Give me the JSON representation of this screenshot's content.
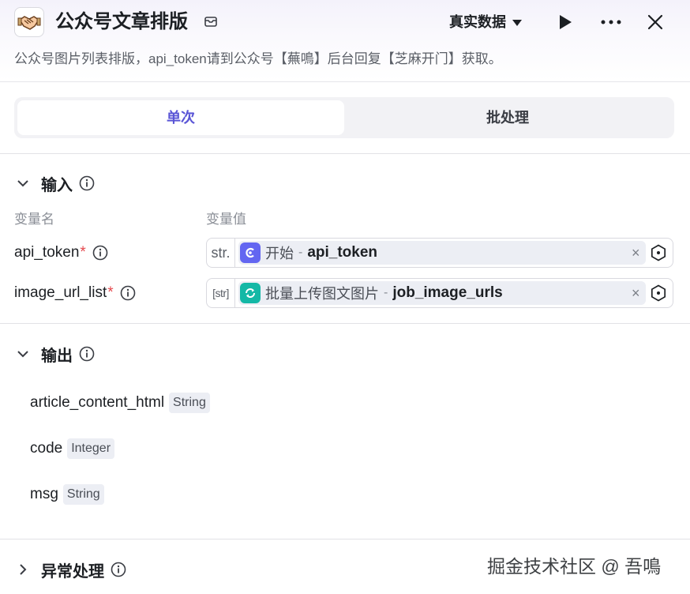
{
  "header": {
    "title": "公众号文章排版",
    "description": "公众号图片列表排版，api_token请到公众号【蕪鳴】后台回复【芝麻开门】获取。",
    "mode": "真实数据",
    "icons": [
      "handshake-icon",
      "card-icon",
      "caret-down-icon",
      "play-icon",
      "more-icon",
      "close-icon"
    ]
  },
  "tabs": [
    {
      "label": "单次",
      "active": true
    },
    {
      "label": "批处理",
      "active": false
    }
  ],
  "input_section": {
    "title": "输入",
    "col_name": "变量名",
    "col_value": "变量值",
    "rows": [
      {
        "name": "api_token",
        "required": "*",
        "type": "str.",
        "node": "开始",
        "sep": "-",
        "field": "api_token",
        "clear": "×"
      },
      {
        "name": "image_url_list",
        "required": "*",
        "type": "[str]",
        "node": "批量上传图文图片",
        "sep": "-",
        "field": "job_image_urls",
        "clear": "×"
      }
    ]
  },
  "output_section": {
    "title": "输出",
    "rows": [
      {
        "name": "article_content_html",
        "type": "String"
      },
      {
        "name": "code",
        "type": "Integer"
      },
      {
        "name": "msg",
        "type": "String"
      }
    ]
  },
  "error_section": {
    "title": "异常处理"
  },
  "watermark": "掘金技术社区 @ 吾鳴",
  "colors": {
    "accent": "#5a55d6",
    "start_node": "#6366f1",
    "loop_node": "#14b8a6",
    "required": "#e5484d"
  }
}
